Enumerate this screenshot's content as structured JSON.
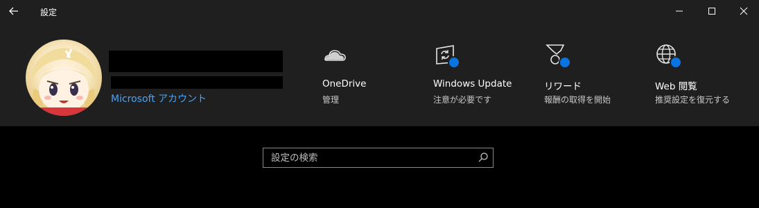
{
  "titlebar": {
    "title": "設定",
    "icons": [
      "back-arrow-icon",
      "minimize-icon",
      "maximize-icon",
      "close-icon"
    ]
  },
  "profile": {
    "account_link": "Microsoft アカウント"
  },
  "tiles": [
    {
      "name": "OneDrive",
      "sub": "管理",
      "icon": "cloud-icon",
      "badge": false
    },
    {
      "name": "Windows Update",
      "sub": "注意が必要です",
      "icon": "update-icon",
      "badge": true
    },
    {
      "name": "リワード",
      "sub": "報酬の取得を開始",
      "icon": "medal-icon",
      "badge": true
    },
    {
      "name": "Web 閲覧",
      "sub": "推奨設定を復元する",
      "icon": "globe-icon",
      "badge": true
    }
  ],
  "search": {
    "placeholder": "設定の検索",
    "icon": "search-icon"
  },
  "colors": {
    "header_bg": "#1f1f1f",
    "body_bg": "#000000",
    "accent_link": "#4aa3f5",
    "badge": "#0a74e0"
  }
}
